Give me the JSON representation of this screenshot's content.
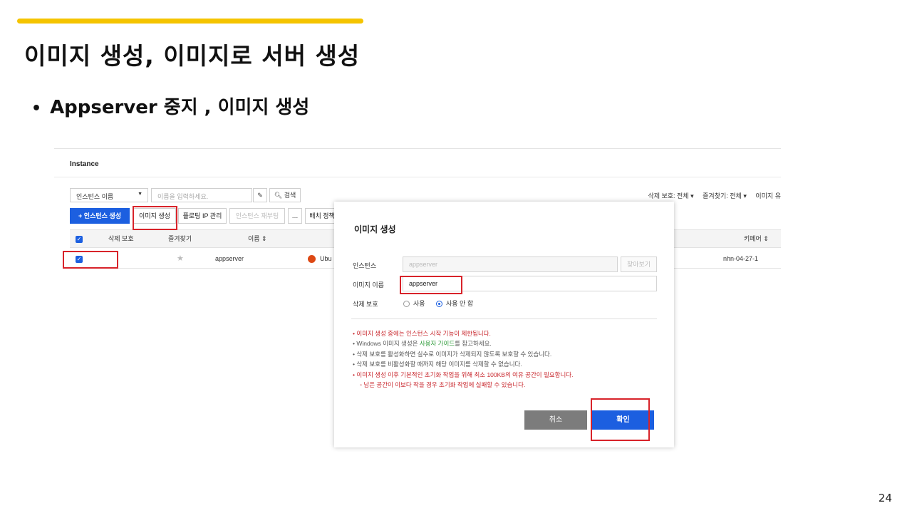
{
  "slide": {
    "title": "이미지 생성, 이미지로 서버 생성",
    "bullet": "Appserver 중지 , 이미지 생성",
    "page_number": "24",
    "accent_color": "#f5c400"
  },
  "console": {
    "section_label": "Instance",
    "search_select": "인스턴스 이름",
    "search_placeholder": "이름을 입력하세요.",
    "search_button": "검색",
    "filters": [
      "삭제 보호: 전체 ▾",
      "즐겨찾기: 전체 ▾",
      "이미지 유"
    ],
    "toolbar": {
      "create_instance": "+  인스턴스 생성",
      "create_image": "이미지 생성",
      "floating_ip": "플로팅 IP 관리",
      "reboot": "인스턴스 재부팅",
      "more": "…",
      "batch": "배치 정책"
    },
    "columns": [
      "삭제 보호",
      "즐겨찾기",
      "이름 ⇕",
      "키페어 ⇕"
    ],
    "row": {
      "name": "appserver",
      "os": "Ubu",
      "keypair": "nhn-04-27-1"
    }
  },
  "modal": {
    "title": "이미지 생성",
    "instance_label": "인스턴스",
    "instance_value": "appserver",
    "find_button": "찾아보기",
    "image_name_label": "이미지 이름",
    "image_name_value": "appserver",
    "delete_protect_label": "삭제 보호",
    "radio_use": "사용",
    "radio_not_use": "사용 안 함",
    "notes": {
      "n1": "• 이미지 생성 중에는 인스턴스 시작 기능이 제한됩니다.",
      "n2_pre": "• Windows 이미지 생성은 ",
      "n2_link": "사용자 가이드",
      "n2_post": "를 참고하세요.",
      "n3": "• 삭제 보호를 활성화하면 실수로 이미지가 삭제되지 않도록 보호할 수 있습니다.",
      "n4": "• 삭제 보호를 비활성화할 때까지 해당 이미지를 삭제할 수 없습니다.",
      "n5": "• 이미지 생성 이후 기본적인 초기화 작업을 위해 최소 100KB의 여유 공간이 필요합니다.",
      "n6": "◦ 남은 공간이 이보다 작을 경우 초기화 작업에 실패할 수 있습니다."
    },
    "cancel_button": "취소",
    "confirm_button": "확인"
  }
}
